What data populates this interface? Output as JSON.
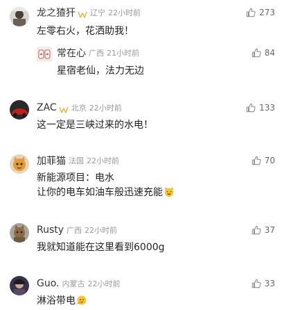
{
  "comments": [
    {
      "name": "龙之猹犴",
      "location": "辽宁",
      "time": "22小时前",
      "text": "左零右火，花洒助我！",
      "likes": "273",
      "badge": "vip-badge-icon"
    },
    {
      "name": "常在心",
      "location": "广西",
      "time": "21小时前",
      "text": "星宿老仙，法力无边",
      "likes": "84"
    },
    {
      "name": "ZAC",
      "location": "北京",
      "time": "22小时前",
      "text": "这一定是三峡过来的水电！",
      "likes": "133",
      "badge": "vip-badge-icon"
    },
    {
      "name": "加菲猫",
      "location": "法国",
      "time": "22小时前",
      "text_line1": "新能源项目：电水",
      "text_line2": "让你的电车如油车般迅速充能",
      "likes": "70",
      "emoji": "grinning-cat-emoji"
    },
    {
      "name": "Rusty",
      "location": "广西",
      "time": "22小时前",
      "text": "我就知道能在这里看到6000g",
      "likes": "37"
    },
    {
      "name": "Guo.",
      "location": "内蒙古",
      "time": "22小时前",
      "text": "淋浴带电",
      "likes": "33",
      "emoji": "thinking-face-emoji"
    }
  ],
  "colors": {
    "name": "#333333",
    "meta": "#9a9a9a",
    "text": "#222222",
    "badge": "#e8b84a"
  }
}
